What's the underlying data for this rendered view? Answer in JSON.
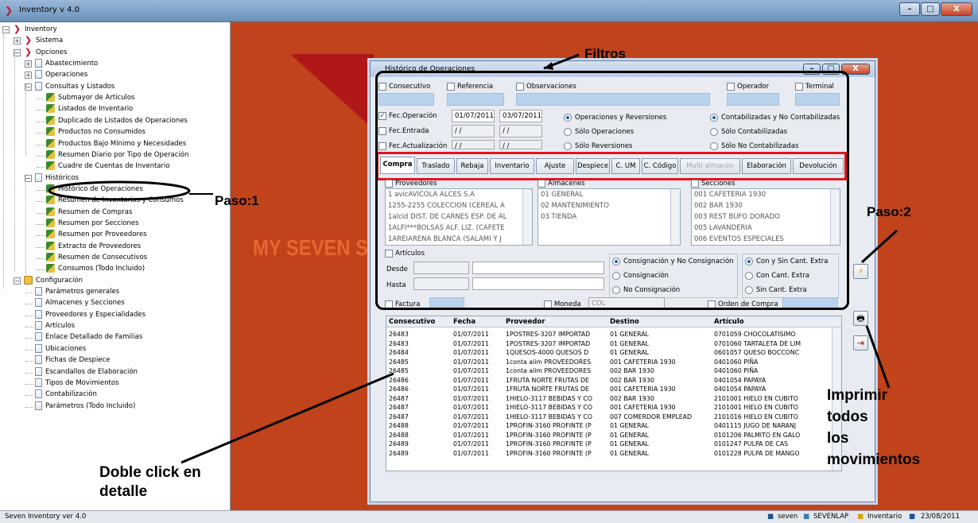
{
  "window": {
    "title": "Inventory v 4.0",
    "min": "–",
    "max": "□",
    "close": "X"
  },
  "brand": {
    "text": "MY SEVEN S"
  },
  "tree": {
    "items": [
      {
        "label": "Inventory",
        "level": 0,
        "icon": "app-icon",
        "pm": "−"
      },
      {
        "label": "Sistema",
        "level": 1,
        "icon": "app-icon",
        "pm": "+"
      },
      {
        "label": "Opciones",
        "level": 1,
        "icon": "app-icon",
        "pm": "−"
      },
      {
        "label": "Abastecimiento",
        "level": 2,
        "icon": "doc-icon",
        "pm": "+"
      },
      {
        "label": "Operaciones",
        "level": 2,
        "icon": "doc-icon",
        "pm": "+"
      },
      {
        "label": "Consultas y Listados",
        "level": 2,
        "icon": "doc-icon",
        "pm": "−"
      },
      {
        "label": "Submayor de Artículos",
        "level": 3,
        "icon": "report-icon"
      },
      {
        "label": "Listados de Inventario",
        "level": 3,
        "icon": "report-icon"
      },
      {
        "label": "Duplicado de Listados de Operaciones",
        "level": 3,
        "icon": "report-icon"
      },
      {
        "label": "Productos no Consumidos",
        "level": 3,
        "icon": "report-icon"
      },
      {
        "label": "Productos Bajo Mínimo y Necesidades",
        "level": 3,
        "icon": "report-icon"
      },
      {
        "label": "Resumen Diario por Tipo de Operación",
        "level": 3,
        "icon": "report-icon"
      },
      {
        "label": "Cuadre de Cuentas de Inventario",
        "level": 3,
        "icon": "report-icon"
      },
      {
        "label": "Históricos",
        "level": 2,
        "icon": "doc-icon",
        "pm": "−"
      },
      {
        "label": "Histórico de Operaciones",
        "level": 3,
        "icon": "report-icon"
      },
      {
        "label": "Resumen de Inventarios y Consumos",
        "level": 3,
        "icon": "report-icon"
      },
      {
        "label": "Resumen de Compras",
        "level": 3,
        "icon": "report-icon"
      },
      {
        "label": "Resumen por Secciones",
        "level": 3,
        "icon": "report-icon"
      },
      {
        "label": "Resumen por Proveedores",
        "level": 3,
        "icon": "report-icon"
      },
      {
        "label": "Extracto de Proveedores",
        "level": 3,
        "icon": "report-icon"
      },
      {
        "label": "Resumen de Consecutivos",
        "level": 3,
        "icon": "report-icon"
      },
      {
        "label": "Consumos (Todo Incluido)",
        "level": 3,
        "icon": "report-icon"
      },
      {
        "label": "Configuración",
        "level": 1,
        "icon": "config-icon",
        "pm": "−"
      },
      {
        "label": "Parámetros generales",
        "level": 2,
        "icon": "doc-icon"
      },
      {
        "label": "Almacenes y Secciones",
        "level": 2,
        "icon": "doc-icon"
      },
      {
        "label": "Proveedores y Especialidades",
        "level": 2,
        "icon": "doc-icon"
      },
      {
        "label": "Artículos",
        "level": 2,
        "icon": "doc-icon"
      },
      {
        "label": "Enlace Detallado de Familias",
        "level": 2,
        "icon": "doc-icon"
      },
      {
        "label": "Ubicaciones",
        "level": 2,
        "icon": "doc-icon"
      },
      {
        "label": "Fichas de Despiece",
        "level": 2,
        "icon": "doc-icon"
      },
      {
        "label": "Escandallos de Elaboración",
        "level": 2,
        "icon": "doc-icon"
      },
      {
        "label": "Tipos de Movimientos",
        "level": 2,
        "icon": "doc-icon"
      },
      {
        "label": "Contabilización",
        "level": 2,
        "icon": "doc-icon"
      },
      {
        "label": "Parámetros (Todo Incluido)",
        "level": 2,
        "icon": "doc-icon"
      }
    ]
  },
  "dialog": {
    "title": "Histórico de Operaciones",
    "filters": {
      "consecutivo": "Consecutivo",
      "referencia": "Referencia",
      "observaciones": "Observaciones",
      "operador": "Operador",
      "terminal": "Terminal",
      "fec_operacion": "Fec.Operación",
      "fec_op_from": "01/07/2011",
      "fec_op_to": "03/07/2011",
      "fec_entrada": "Fec.Entrada",
      "fec_actualizacion": "Fec.Actualización",
      "empty_date": " / /",
      "radio_ops": [
        "Operaciones y Reversiones",
        "Sólo Operaciones",
        "Sólo Reversiones"
      ],
      "radio_cont": [
        "Contabilizadas y No Contabilizadas",
        "Sólo Contabilizadas",
        "Sólo No Contabilizadas"
      ]
    },
    "tabs": [
      "Compra",
      "Traslado",
      "Rebaja",
      "Inventario",
      "Ajuste",
      "Despiece",
      "C. UM",
      "C. Código",
      "Multi almacén",
      "Elaboración",
      "Devolución"
    ],
    "proveedores": {
      "label": "Proveedores",
      "items": [
        "1 avicAVICOLA ALCES S.A",
        "1255-2255 COLECCION (CEREAL A",
        "1alcid DIST. DE CARNES ESP. DE AL",
        "1ALFI***BOLSAS ALF. LIZ. (CAFETE",
        "1AREIARENA BLANCA (SALAMI Y J"
      ]
    },
    "almacenes": {
      "label": "Almacenes",
      "items": [
        "01  GENERAL",
        "02  MANTENIMIENTO",
        "03  TIENDA"
      ]
    },
    "secciones": {
      "label": "Secciones",
      "items": [
        "001   CAFETERIA 1930",
        "002   BAR 1930",
        "003   REST BUFO DORADO",
        "005   LAVANDERIA",
        "006   EVENTOS ESPECIALES"
      ]
    },
    "articulos": "Artículos",
    "desde": "Desde",
    "hasta": "Hasta",
    "radio_consig": [
      "Consignación y No Consignación",
      "Consignación",
      "No Consignación"
    ],
    "radio_cant": [
      "Con y Sin Cant. Extra",
      "Con Cant. Extra",
      "Sin Cant. Extra"
    ],
    "factura": "Factura",
    "moneda": "Moneda",
    "moneda_value": "COL",
    "orden_compra": "Orden de Compra",
    "grid": {
      "columns": [
        "Consecutivo",
        "Fecha",
        "Proveedor",
        "Destino",
        "Artículo"
      ],
      "rows": [
        [
          "26483",
          "01/07/2011",
          "1POSTRES-3207 IMPORTAD",
          "01 GENERAL",
          "0701059 CHOCOLATISIMO"
        ],
        [
          "26483",
          "01/07/2011",
          "1POSTRES-3207 IMPORTAD",
          "01 GENERAL",
          "0701060 TARTALETA DE LIM"
        ],
        [
          "26484",
          "01/07/2011",
          "1QUESOS-4000 QUESOS D",
          "01 GENERAL",
          "0601057 QUESO BOCCONC"
        ],
        [
          "26485",
          "01/07/2011",
          "1conta alim PROVEEDORES",
          "001 CAFETERIA 1930",
          "0401060 PIÑA"
        ],
        [
          "26485",
          "01/07/2011",
          "1conta alim PROVEEDORES",
          "002 BAR 1930",
          "0401060 PIÑA"
        ],
        [
          "26486",
          "01/07/2011",
          "1FRUTA NORTE FRUTAS DE",
          "002 BAR 1930",
          "0401054 PAPAYA"
        ],
        [
          "26486",
          "01/07/2011",
          "1FRUTA NORTE FRUTAS DE",
          "001 CAFETERIA 1930",
          "0401054 PAPAYA"
        ],
        [
          "26487",
          "01/07/2011",
          "1HIELO-3117 BEBIDAS Y CO",
          "002 BAR 1930",
          "2101001 HIELO EN CUBITO"
        ],
        [
          "26487",
          "01/07/2011",
          "1HIELO-3117 BEBIDAS Y CO",
          "001 CAFETERIA 1930",
          "2101001 HIELO EN CUBITO"
        ],
        [
          "26487",
          "01/07/2011",
          "1HIELO-3117 BEBIDAS Y CO",
          "007 COMERDOR EMPLEAD",
          "2101016 HIELO EN CUBITO"
        ],
        [
          "26488",
          "01/07/2011",
          "1PROFIN-3160 PROFINTE (P",
          "01 GENERAL",
          "0401115 JUGO DE NARANJ"
        ],
        [
          "26488",
          "01/07/2011",
          "1PROFIN-3160 PROFINTE (P",
          "01 GENERAL",
          "0101206 PALMITO EN GALO"
        ],
        [
          "26489",
          "01/07/2011",
          "1PROFIN-3160 PROFINTE (P",
          "01 GENERAL",
          "0101247 PULPA DE CAS"
        ],
        [
          "26489",
          "01/07/2011",
          "1PROFIN-3160 PROFINTE (P",
          "01 GENERAL",
          "0101228 PULPA DE MANGO"
        ]
      ]
    }
  },
  "side_buttons": {
    "b1": "⚡",
    "b2": "🖶",
    "b3": "⇥"
  },
  "annotations": {
    "filtros": "Filtros",
    "paso1": "Paso:1",
    "paso2": "Paso:2",
    "doble_click": "Doble click en\ndetalle",
    "imprimir": "Imprimir\ntodos\nlos\nmovimientos"
  },
  "status": {
    "left": "Seven Inventory ver 4.0",
    "user": "seven",
    "machine": "SEVENLAP",
    "module": "Inventario",
    "date": "23/08/2011"
  },
  "colors": {
    "background": "#c0431c",
    "highlight_red": "#e0151f",
    "field_blue": "#b9d3ee"
  }
}
